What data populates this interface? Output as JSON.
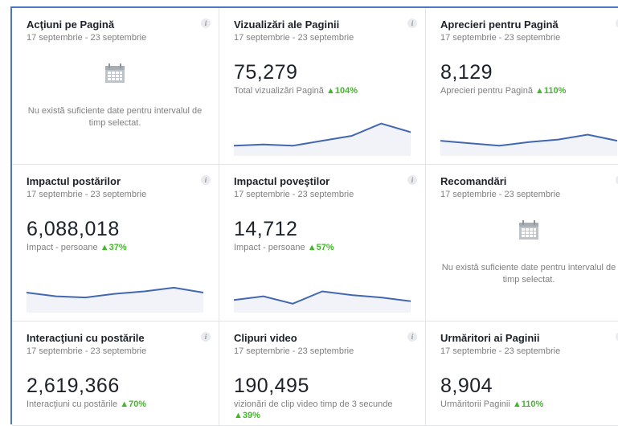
{
  "colors": {
    "accent": "#4a76c6",
    "positive": "#42b72a",
    "spark_line": "#4267b2",
    "spark_fill": "#f1f3f8"
  },
  "info_icon_glyph": "i",
  "cards": [
    {
      "title": "Acţiuni pe Pagină",
      "date": "17 septembrie - 23 septembrie",
      "empty_message": "Nu există suficiente date pentru intervalul de timp selectat."
    },
    {
      "title": "Vizualizări ale Paginii",
      "date": "17 septembrie - 23 septembrie",
      "value": "75,279",
      "sub_label": "Total vizualizări Pagină",
      "change": "▲104%",
      "trend": [
        22,
        23,
        22,
        26,
        30,
        40,
        33
      ]
    },
    {
      "title": "Aprecieri pentru Pagină",
      "date": "17 septembrie - 23 septembrie",
      "value": "8,129",
      "sub_label": "Aprecieri pentru Pagină",
      "change": "▲110%",
      "trend": [
        26,
        24,
        22,
        25,
        27,
        31,
        26
      ]
    },
    {
      "title": "Impactul postărilor",
      "date": "17 septembrie - 23 septembrie",
      "value": "6,088,018",
      "sub_label": "Impact - persoane",
      "change": "▲37%",
      "trend": [
        30,
        27,
        26,
        29,
        31,
        34,
        30
      ]
    },
    {
      "title": "Impactul poveştilor",
      "date": "17 septembrie - 23 septembrie",
      "value": "14,712",
      "sub_label": "Impact - persoane",
      "change": "▲57%",
      "trend": [
        24,
        27,
        21,
        31,
        28,
        26,
        23
      ]
    },
    {
      "title": "Recomandări",
      "date": "17 septembrie - 23 septembrie",
      "empty_message": "Nu există suficiente date pentru intervalul de timp selectat."
    },
    {
      "title": "Interacţiuni cu postările",
      "date": "17 septembrie - 23 septembrie",
      "value": "2,619,366",
      "sub_label": "Interacţiuni cu postările",
      "change": "▲70%"
    },
    {
      "title": "Clipuri video",
      "date": "17 septembrie - 23 septembrie",
      "value": "190,495",
      "sub_label": "vizionări de clip video timp de 3 secunde",
      "change": "▲39%"
    },
    {
      "title": "Urmăritori ai Paginii",
      "date": "17 septembrie - 23 septembrie",
      "value": "8,904",
      "sub_label": "Urmăritorii Paginii",
      "change": "▲110%"
    }
  ]
}
